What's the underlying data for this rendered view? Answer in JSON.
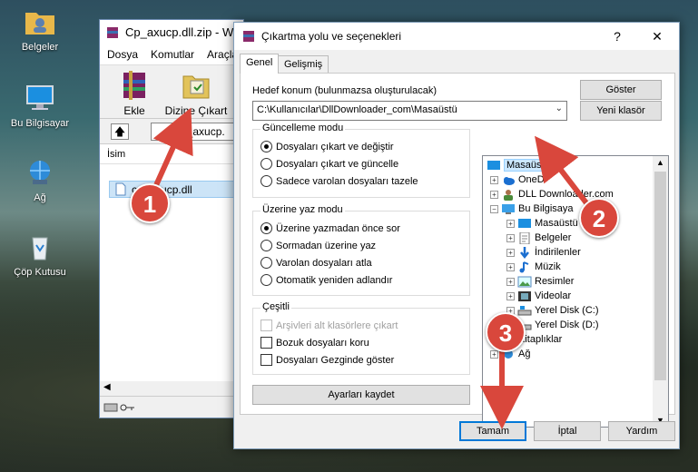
{
  "desktop": {
    "icons": [
      {
        "label": "Belgeler",
        "icon": "folder-user-icon"
      },
      {
        "label": "Bu Bilgisayar",
        "icon": "computer-icon"
      },
      {
        "label": "Ağ",
        "icon": "network-icon"
      },
      {
        "label": "Çöp Kutusu",
        "icon": "recycle-bin-icon"
      }
    ]
  },
  "winrar": {
    "title": "Cp_axucp.dll.zip - W",
    "menu": [
      "Dosya",
      "Komutlar",
      "Araçla"
    ],
    "toolbar": {
      "add_label": "Ekle",
      "extract_label": "Dizine Çıkart"
    },
    "path": "p_axucp.",
    "column_name": "İsim",
    "file": "cp_axucp.dll"
  },
  "dialog": {
    "title": "Çıkartma yolu ve seçenekleri",
    "help": "?",
    "close": "✕",
    "tabs": [
      "Genel",
      "Gelişmiş"
    ],
    "destination_label": "Hedef konum (bulunmazsa oluşturulacak)",
    "destination_value": "C:\\Kullanıcılar\\DllDownloader_com\\Masaüstü",
    "show_button": "Göster",
    "new_folder_button": "Yeni klasör",
    "update_mode": {
      "title": "Güncelleme modu",
      "options": [
        "Dosyaları çıkart ve değiştir",
        "Dosyaları çıkart ve güncelle",
        "Sadece varolan dosyaları tazele"
      ],
      "selected": 0
    },
    "overwrite_mode": {
      "title": "Üzerine yaz modu",
      "options": [
        "Üzerine yazmadan önce sor",
        "Sormadan üzerine yaz",
        "Varolan dosyaları atla",
        "Otomatik yeniden adlandır"
      ],
      "selected": 0
    },
    "misc": {
      "title": "Çeşitli",
      "options": [
        "Arşivleri alt klasörlere çıkart",
        "Bozuk dosyaları koru",
        "Dosyaları Gezginde göster"
      ],
      "disabled": [
        true,
        false,
        false
      ]
    },
    "save_settings_button": "Ayarları kaydet",
    "tree": {
      "items": [
        "Masaüstü",
        "OneD",
        "DLL Downloader.com",
        "Bu Bilgisaya",
        "Masaüstü",
        "Belgeler",
        "İndirilenler",
        "Müzik",
        "Resimler",
        "Videolar",
        "Yerel Disk (C:)",
        "Yerel Disk (D:)",
        "Kitaplıklar",
        "Ağ"
      ]
    },
    "ok_button": "Tamam",
    "cancel_button": "İptal",
    "help_button": "Yardım"
  },
  "annotations": {
    "steps": [
      "1",
      "2",
      "3"
    ],
    "color": "#d9473c"
  }
}
